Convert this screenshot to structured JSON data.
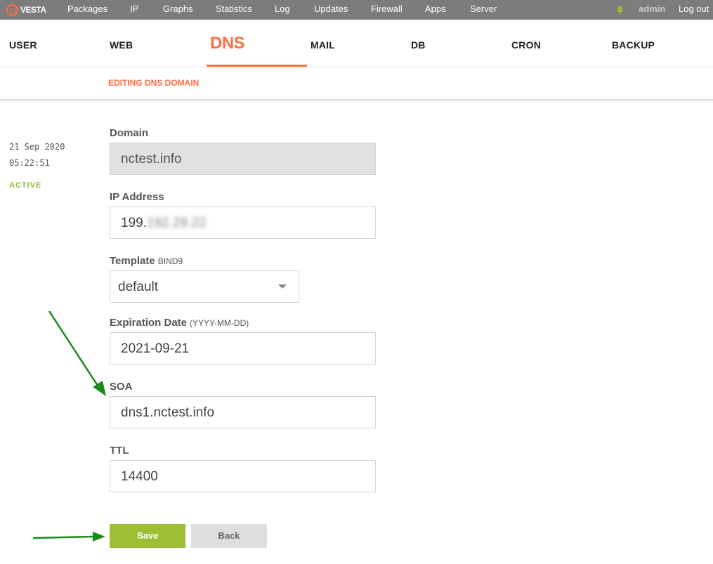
{
  "logo": {
    "text": "VESTA",
    "color": "#ff6e42"
  },
  "top_nav": {
    "items": [
      "Packages",
      "IP",
      "Graphs",
      "Statistics",
      "Log",
      "Updates",
      "Firewall",
      "Apps",
      "Server"
    ],
    "user": "admin",
    "logout": "Log out",
    "notification_icon": "bell-icon",
    "notification_color": "#9cbf33"
  },
  "main_nav": {
    "tabs": [
      "USER",
      "WEB",
      "DNS",
      "MAIL",
      "DB",
      "CRON",
      "BACKUP"
    ],
    "active": "DNS",
    "accent_color": "#ff6e42"
  },
  "subtitle": "EDITING DNS DOMAIN",
  "meta": {
    "date": "21 Sep 2020",
    "time": "05:22:51",
    "status": "ACTIVE",
    "status_color": "#8dba2f"
  },
  "form": {
    "domain": {
      "label": "Domain",
      "value": "nctest.info"
    },
    "ip": {
      "label": "IP Address",
      "value_prefix": "199.",
      "value_blurred": "192.29.22"
    },
    "template": {
      "label": "Template",
      "hint": "BIND9",
      "value": "default"
    },
    "expiration": {
      "label": "Expiration Date",
      "hint": "(YYYY-MM-DD)",
      "value": "2021-09-21"
    },
    "soa": {
      "label": "SOA",
      "value": "dns1.nctest.info"
    },
    "ttl": {
      "label": "TTL",
      "value": "14400"
    }
  },
  "buttons": {
    "save": "Save",
    "back": "Back",
    "save_color": "#9cbf33"
  },
  "annotation_color": "#1a8a1a"
}
